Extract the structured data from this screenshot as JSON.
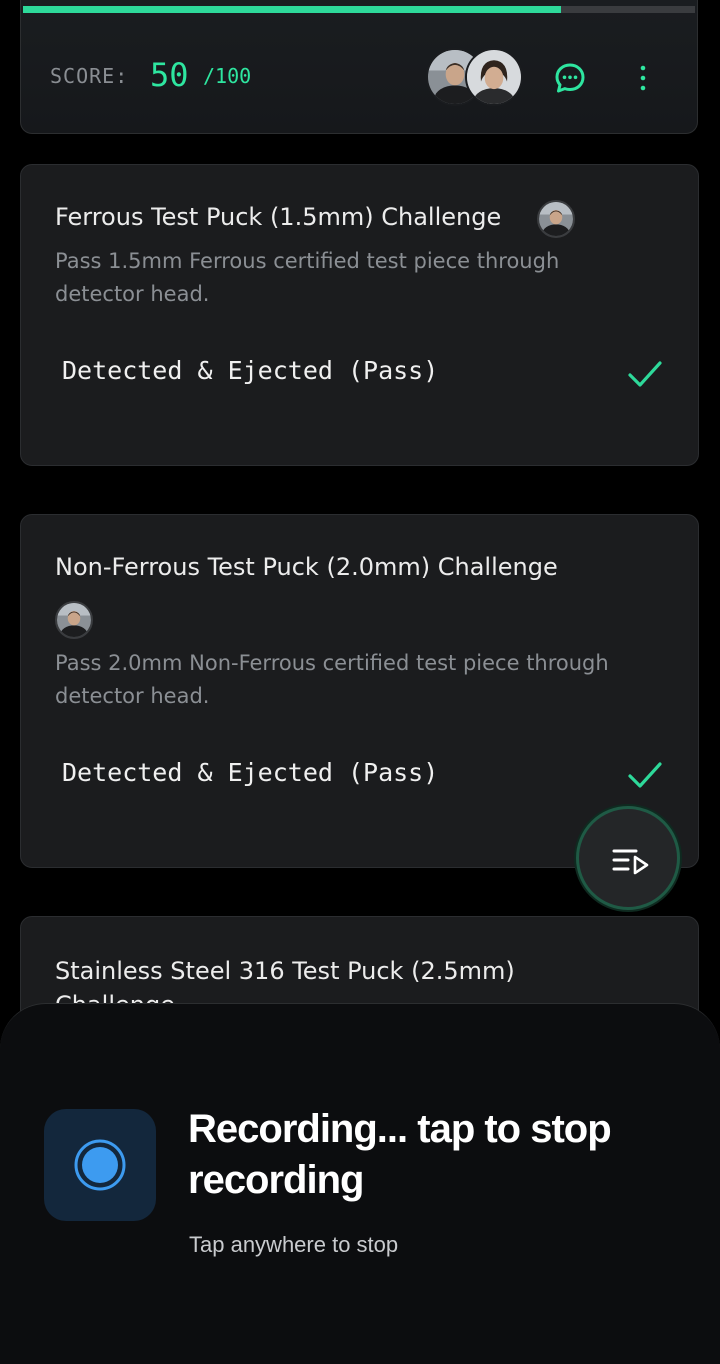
{
  "score": {
    "label": "SCORE:",
    "value": "50",
    "max": "/100",
    "progress": 0.8,
    "accent_color": "#2ee6a0"
  },
  "header_actions": {
    "participants": [
      "avatar-male",
      "avatar-female"
    ],
    "chat_icon": "chat-bubble-icon",
    "more_icon": "more-vertical-icon"
  },
  "tasks": [
    {
      "title": "Ferrous Test Puck (1.5mm) Challenge",
      "description": "Pass 1.5mm Ferrous certified test piece through detector head.",
      "result": "Detected & Ejected (Pass)",
      "status_icon": "check-icon"
    },
    {
      "title": "Non-Ferrous Test Puck (2.0mm) Challenge",
      "description": "Pass 2.0mm Non-Ferrous certified test piece through detector head.",
      "result": "Detected & Ejected (Pass)",
      "status_icon": "check-icon"
    },
    {
      "title": "Stainless Steel 316 Test Puck (2.5mm)",
      "title_line2": "Challenge"
    }
  ],
  "fab": {
    "icon": "playlist-play-icon"
  },
  "recording": {
    "title": "Recording... tap to stop recording",
    "subtitle": "Tap anywhere to stop",
    "icon": "record-icon"
  }
}
